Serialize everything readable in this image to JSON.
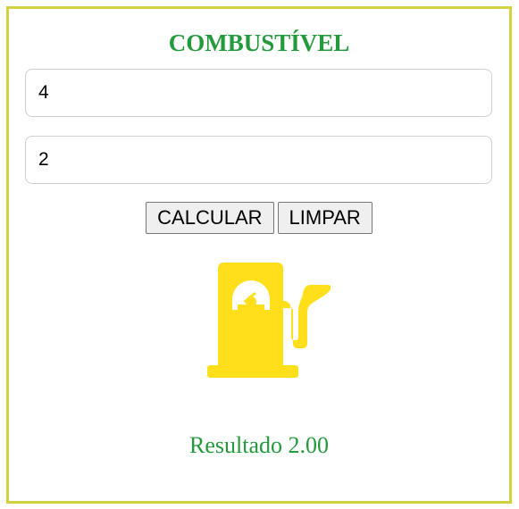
{
  "title": "COMBUSTÍVEL",
  "inputs": {
    "first_value": "4",
    "second_value": "2"
  },
  "buttons": {
    "calculate_label": "CALCULAR",
    "clear_label": "LIMPAR"
  },
  "image": {
    "icon": "fuel-pump-icon",
    "color": "#ffde1a"
  },
  "result": {
    "text": "Resultado 2.00"
  },
  "colors": {
    "border": "#d4d13f",
    "accent": "#239a3b"
  }
}
